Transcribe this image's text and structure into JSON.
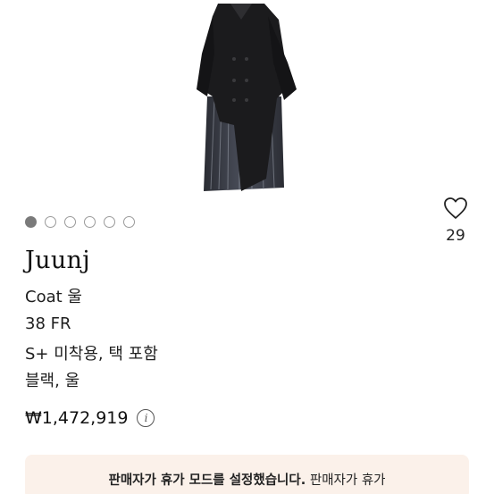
{
  "product": {
    "brand": "Juunj",
    "category_line": "Coat 울",
    "size": "38 FR",
    "condition": "S+ 미착용, 택 포함",
    "color_material": "블랙, 울",
    "price": "₩1,472,919"
  },
  "likes": {
    "count": "29",
    "icon": "heart-outline-icon"
  },
  "carousel": {
    "total": 6,
    "active": 1
  },
  "notice": {
    "bold_text": "판매자가 휴가 모드를 설정했습니다.",
    "text": " 판매자가 휴가"
  },
  "info_icon_glyph": "i",
  "colors": {
    "notice_bg": "#fbf1ea",
    "coat": "#1b1b1d"
  }
}
